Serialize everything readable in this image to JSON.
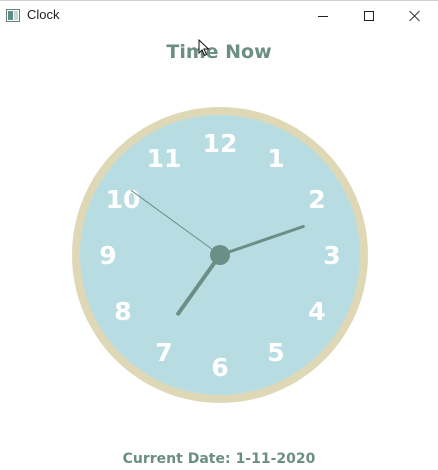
{
  "window": {
    "title": "Clock",
    "icon": "clock-app-icon",
    "controls": [
      "minimize",
      "maximize",
      "close"
    ]
  },
  "heading": "Time Now",
  "clock": {
    "numerals": [
      "12",
      "1",
      "2",
      "3",
      "4",
      "5",
      "6",
      "7",
      "8",
      "9",
      "10",
      "11"
    ],
    "time": {
      "hour": 7,
      "minute": 11,
      "second": 51
    },
    "colors": {
      "face": "#b7dde3",
      "rim": "#dfd8b6",
      "hands": "#6b8e85",
      "numerals": "#ffffff"
    }
  },
  "footer": {
    "label": "Current Date:",
    "date": "1-11-2020"
  },
  "colors": {
    "accent": "#6b8e85"
  }
}
